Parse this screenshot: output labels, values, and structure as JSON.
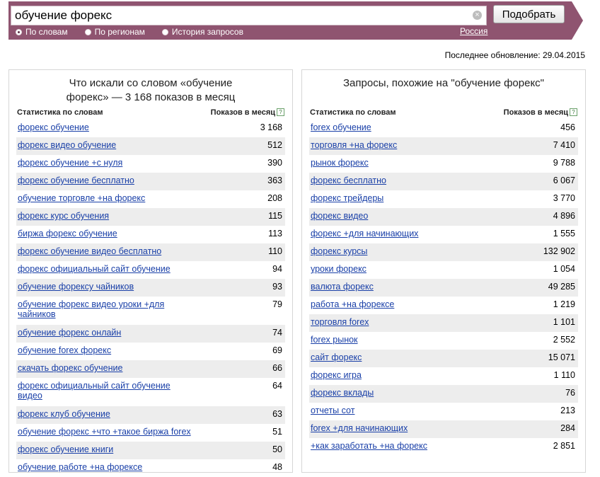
{
  "search": {
    "value": "обучение форекс",
    "submit_label": "Подобрать",
    "clear_icon": "clear-icon"
  },
  "modes": [
    {
      "label": "По словам",
      "selected": true
    },
    {
      "label": "По регионам",
      "selected": false
    },
    {
      "label": "История запросов",
      "selected": false
    }
  ],
  "region": "Россия",
  "updated": "Последнее обновление: 29.04.2015",
  "left": {
    "title": "Что искали со словом «обучение форекс» — 3 168 показов в месяц",
    "col_query": "Статистика по словам",
    "col_count": "Показов в месяц",
    "help": "?",
    "rows": [
      {
        "q": "форекс обучение",
        "v": "3 168"
      },
      {
        "q": "форекс видео обучение",
        "v": "512"
      },
      {
        "q": "форекс обучение +с нуля",
        "v": "390"
      },
      {
        "q": "форекс обучение бесплатно",
        "v": "363"
      },
      {
        "q": "обучение торговле +на форекс",
        "v": "208"
      },
      {
        "q": "форекс курс обучения",
        "v": "115"
      },
      {
        "q": "биржа форекс обучение",
        "v": "113"
      },
      {
        "q": "форекс обучение видео бесплатно",
        "v": "110"
      },
      {
        "q": "форекс официальный сайт обучение",
        "v": "94"
      },
      {
        "q": "обучение форексу чайников",
        "v": "93"
      },
      {
        "q": "обучение форекс видео уроки +для чайников",
        "v": "79"
      },
      {
        "q": "обучение форекс онлайн",
        "v": "74"
      },
      {
        "q": "обучение forex форекс",
        "v": "69"
      },
      {
        "q": "скачать форекс обучение",
        "v": "66"
      },
      {
        "q": "форекс официальный сайт обучение видео",
        "v": "64"
      },
      {
        "q": "форекс клуб обучение",
        "v": "63"
      },
      {
        "q": "обучение форекс +что +такое биржа forex",
        "v": "51"
      },
      {
        "q": "форекс обучение книги",
        "v": "50"
      },
      {
        "q": "обучение работе +на форексе",
        "v": "48"
      }
    ]
  },
  "right": {
    "title": "Запросы, похожие на \"обучение форекс\"",
    "col_query": "Статистика по словам",
    "col_count": "Показов в месяц",
    "help": "?",
    "rows": [
      {
        "q": "forex обучение",
        "v": "456"
      },
      {
        "q": "торговля +на форекс",
        "v": "7 410"
      },
      {
        "q": "рынок форекс",
        "v": "9 788"
      },
      {
        "q": "форекс бесплатно",
        "v": "6 067"
      },
      {
        "q": "форекс трейдеры",
        "v": "3 770"
      },
      {
        "q": "форекс видео",
        "v": "4 896"
      },
      {
        "q": "форекс +для начинающих",
        "v": "1 555"
      },
      {
        "q": "форекс курсы",
        "v": "132 902"
      },
      {
        "q": "уроки форекс",
        "v": "1 054"
      },
      {
        "q": "валюта форекс",
        "v": "49 285"
      },
      {
        "q": "работа +на форексе",
        "v": "1 219"
      },
      {
        "q": "торговля forex",
        "v": "1 101"
      },
      {
        "q": "forex рынок",
        "v": "2 552"
      },
      {
        "q": "сайт форекс",
        "v": "15 071"
      },
      {
        "q": "форекс игра",
        "v": "1 110"
      },
      {
        "q": "форекс вклады",
        "v": "76"
      },
      {
        "q": "отчеты сот",
        "v": "213"
      },
      {
        "q": "forex +для начинающих",
        "v": "284"
      },
      {
        "q": "+как заработать +на форекс",
        "v": "2 851"
      }
    ]
  }
}
